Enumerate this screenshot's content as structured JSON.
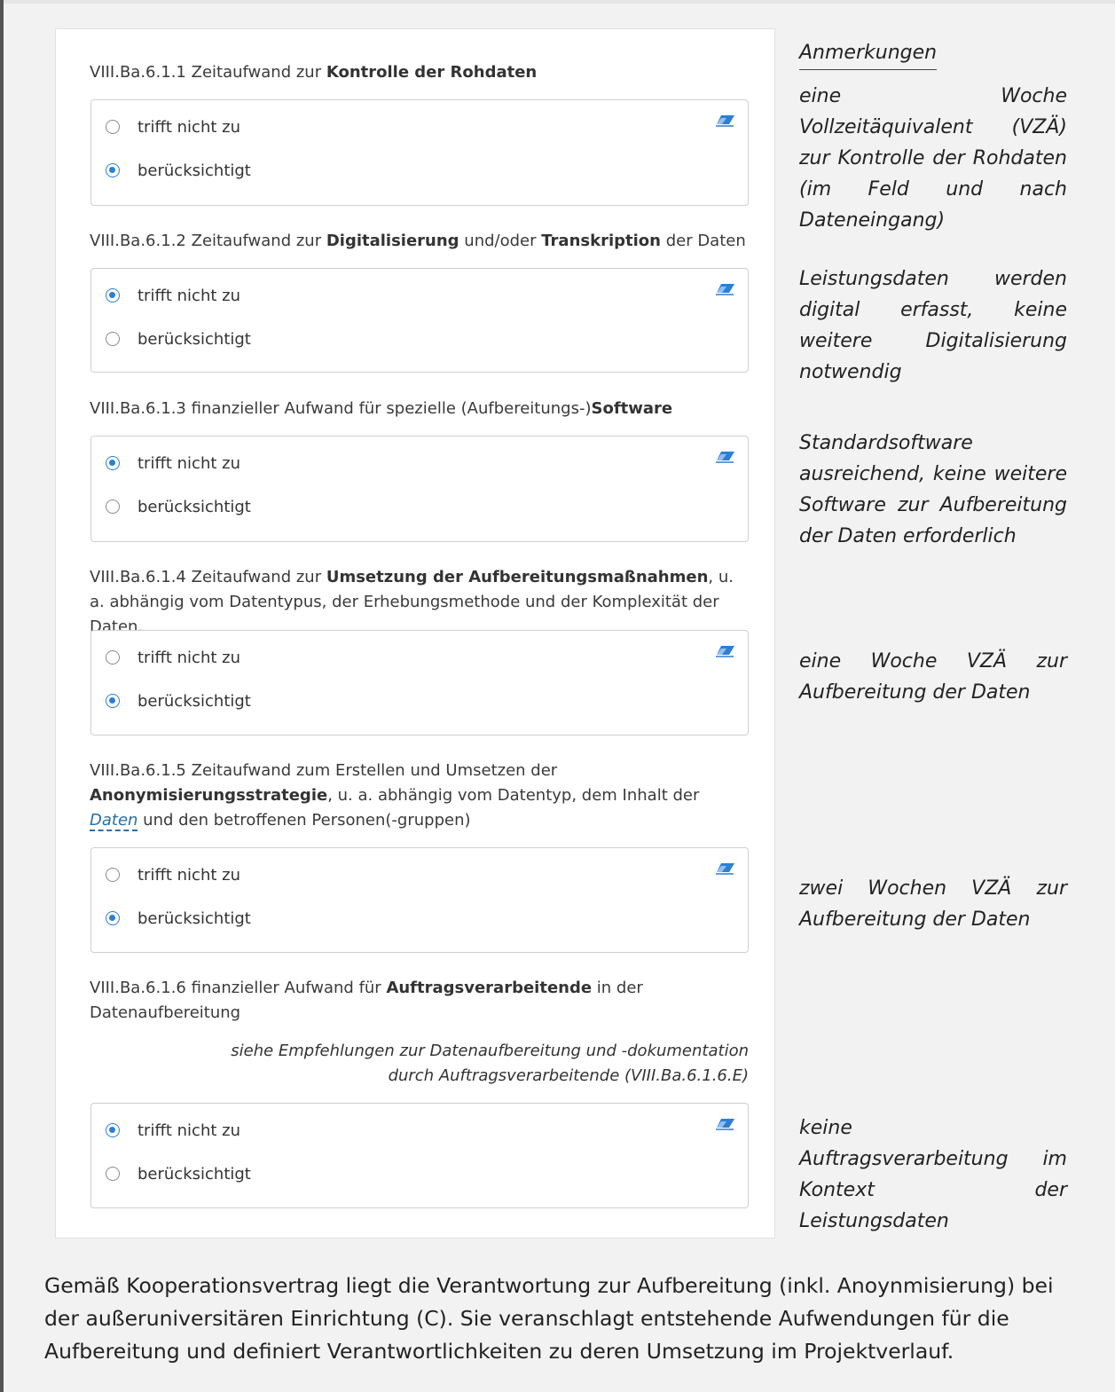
{
  "notes_heading": "Anmerkungen",
  "items": [
    {
      "id": "VIII.Ba.6.1.1",
      "label_parts": [
        "Zeitaufwand zur ",
        "Kontrolle der Rohdaten"
      ],
      "options": [
        "trifft nicht zu",
        "berücksichtigt"
      ],
      "selected": "berücksichtigt",
      "note": "eine Woche Vollzeitäquivalent (VZÄ) zur Kontrolle der Rohdaten (im Feld und nach Dateneingang)"
    },
    {
      "id": "VIII.Ba.6.1.2",
      "label_parts": [
        "Zeitaufwand zur ",
        "Digitalisierung",
        " und/oder ",
        "Transkription",
        " der Daten"
      ],
      "options": [
        "trifft nicht zu",
        "berücksichtigt"
      ],
      "selected": "trifft nicht zu",
      "note": "Leistungsdaten werden digital erfasst, keine weitere Digitalisierung notwendig"
    },
    {
      "id": "VIII.Ba.6.1.3",
      "label_parts": [
        "finanzieller Aufwand für spezielle (Aufbereitungs-)",
        "Software"
      ],
      "options": [
        "trifft nicht zu",
        "berücksichtigt"
      ],
      "selected": "trifft nicht zu",
      "note": "Standardsoftware ausreichend, keine weitere Software zur Aufbereitung der Daten erforderlich"
    },
    {
      "id": "VIII.Ba.6.1.4",
      "label_parts": [
        "Zeitaufwand zur ",
        "Umsetzung der Aufbereitungsmaßnahmen",
        ", u. a. abhängig vom Datentypus, der Erhebungsmethode und der Komplexität der Daten,"
      ],
      "options": [
        "trifft nicht zu",
        "berücksichtigt"
      ],
      "selected": "berücksichtigt",
      "note": "eine Woche VZÄ zur Aufbereitung der Daten"
    },
    {
      "id": "VIII.Ba.6.1.5",
      "label_parts": [
        "Zeitaufwand zum Erstellen und Umsetzen der ",
        "Anonymisierungsstrategie",
        ", u. a. abhängig vom Datentyp, dem Inhalt der ",
        "Daten",
        " und den betroffenen Personen(-gruppen)"
      ],
      "options": [
        "trifft nicht zu",
        "berücksichtigt"
      ],
      "selected": "berücksichtigt",
      "note": "zwei Wochen VZÄ zur Aufbereitung der Daten"
    },
    {
      "id": "VIII.Ba.6.1.6",
      "label_parts": [
        "finanzieller Aufwand für ",
        "Auftragsverarbeitende",
        " in der Datenaufbereitung"
      ],
      "hint_line1": "siehe Empfehlungen zur Datenaufbereitung und -dokumentation",
      "hint_line2": "durch Auftragsverarbeitende (VIII.Ba.6.1.6.E)",
      "options": [
        "trifft nicht zu",
        "berücksichtigt"
      ],
      "selected": "trifft nicht zu",
      "note": "keine Auftragsverarbeitung im Kontext der Leistungsdaten"
    }
  ],
  "footer": "Gemäß Kooperationsvertrag liegt die Verantwortung zur Aufbereitung (inkl. Anoynmisierung) bei der außeruniversitären Einrichtung (C). Sie veranschlagt entstehende Aufwendungen für die Aufbereitung und definiert Verantwortlichkeiten zu deren Umsetzung im Projektverlauf.",
  "colors": {
    "accent": "#2b7fd6",
    "link": "#2a6ea8"
  },
  "icons": {
    "edit": "eraser-icon"
  }
}
